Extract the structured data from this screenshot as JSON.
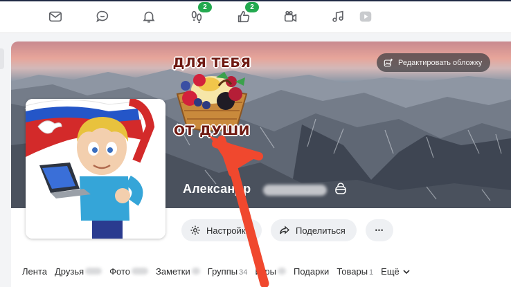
{
  "topbar": {
    "icons": [
      "mail-icon",
      "chat-bubble-icon",
      "bell-icon",
      "footprints-icon",
      "thumbs-up-icon",
      "video-camera-icon",
      "music-note-icon",
      "video-play-icon"
    ],
    "guests_badge": "2",
    "likes_badge": "2"
  },
  "cover": {
    "edit_label": "Редактировать обложку",
    "sticker_top": "ДЛЯ ТЕБЯ",
    "sticker_bottom": "ОТ ДУШИ"
  },
  "profile": {
    "name_visible": "Александр"
  },
  "actions": {
    "settings_label": "Настройки",
    "share_label": "Поделиться",
    "more_label": "•••"
  },
  "tabs": [
    {
      "label": "Лента",
      "count": ""
    },
    {
      "label": "Друзья",
      "count": ""
    },
    {
      "label": "Фото",
      "count": ""
    },
    {
      "label": "Заметки",
      "count": ""
    },
    {
      "label": "Группы",
      "count": "34"
    },
    {
      "label": "Игры",
      "count": ""
    },
    {
      "label": "Подарки",
      "count": ""
    },
    {
      "label": "Товары",
      "count": "1"
    },
    {
      "label": "Ещё",
      "count": ""
    }
  ],
  "colors": {
    "accent_badge": "#23a94f",
    "annotation_arrow": "#f0482e"
  }
}
